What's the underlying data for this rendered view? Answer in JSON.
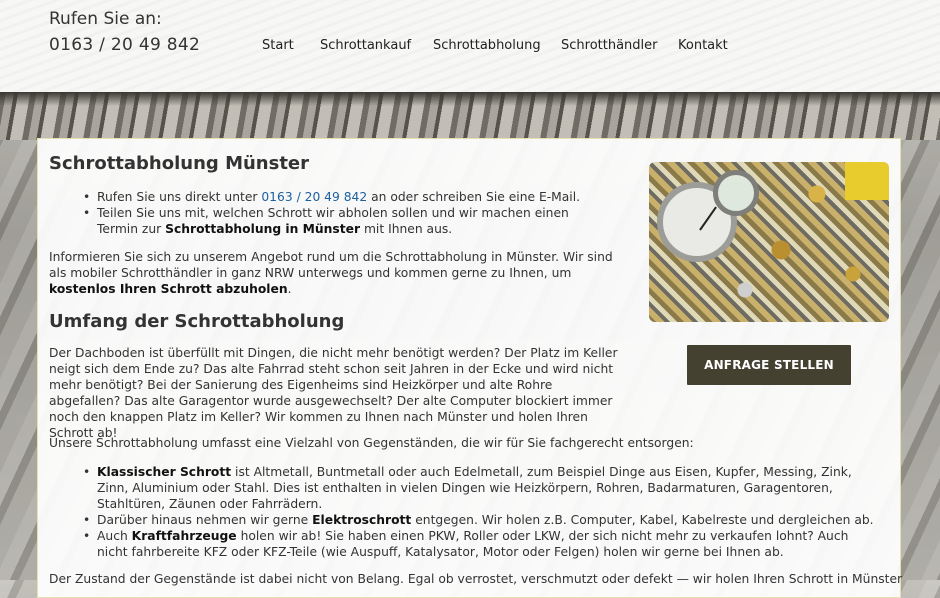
{
  "header": {
    "phone_label": "Rufen Sie an:",
    "phone_number": "0163 / 20 49 842",
    "nav": [
      "Start",
      "Schrottankauf",
      "Schrottabholung",
      "Schrotthändler",
      "Kontakt"
    ]
  },
  "main": {
    "title": "Schrottabholung Münster",
    "intro_bullets": [
      {
        "a": "Rufen Sie uns direkt unter ",
        "link": "0163 / 20 49 842",
        "b": " an oder schreiben Sie eine E-Mail."
      },
      {
        "a": "Teilen Sie uns mit, welchen Schrott wir abholen sollen und wir machen einen Termin zur ",
        "bold": "Schrottabholung in Münster",
        "b": " mit Ihnen aus."
      }
    ],
    "intro_paragraph": {
      "a": "Informieren Sie sich zu unserem Angebot rund um die Schrottabholung in Münster. Wir sind als mobiler Schrotthändler in ganz NRW unterwegs und kommen gerne zu Ihnen, um ",
      "bold": "kostenlos Ihren Schrott abzuholen",
      "b": "."
    },
    "section_title": "Umfang der Schrottabholung",
    "section_paragraph": "Der Dachboden ist überfüllt mit Dingen, die nicht mehr benötigt werden? Der Platz im Keller neigt sich dem Ende zu? Das alte Fahrrad steht schon seit Jahren in der Ecke und wird nicht mehr benötigt? Bei der Sanierung des Eigenheims sind Heizkörper und alte Rohre abgefallen? Das alte Garagentor wurde ausgewechselt? Der alte Computer blockiert immer noch den knappen Platz im Keller? Wir kommen zu Ihnen nach Münster und holen Ihren Schrott ab!",
    "items_intro": "Unsere Schrottabholung umfasst eine Vielzahl von Gegenständen, die wir für Sie fachgerecht entsorgen:",
    "items": [
      {
        "a": "",
        "bold": "Klassischer Schrott",
        "b": " ist Altmetall, Buntmetall oder auch Edelmetall, zum Beispiel Dinge aus Eisen, Kupfer, Messing, Zink, Zinn, Aluminium oder Stahl. Dies ist enthalten in vielen Dingen wie Heizkörpern, Rohren, Badarmaturen, Garagentoren, Stahltüren, Zäunen oder Fahrrädern."
      },
      {
        "a": "Darüber hinaus nehmen wir gerne ",
        "bold": "Elektroschrott",
        "b": " entgegen. Wir holen z.B. Computer, Kabel, Kabelreste und dergleichen ab."
      },
      {
        "a": "Auch ",
        "bold": "Kraftfahrzeuge",
        "b": " holen wir ab! Sie haben einen PKW, Roller oder LKW, der sich nicht mehr zu verkaufen lohnt? Auch nicht fahrbereite KFZ oder KFZ-Teile (wie Auspuff, Katalysator, Motor oder Felgen) holen wir gerne bei Ihnen ab."
      }
    ],
    "closing_partial": "Der Zustand der Gegenstände ist dabei nicht von Belang. Egal ob verrostet, verschmutzt oder defekt — wir holen Ihren Schrott in Münster"
  },
  "sidebar": {
    "cta_label": "ANFRAGE STELLEN"
  },
  "colors": {
    "cta_bg": "#444131",
    "link": "#1b5f9e",
    "panel_border": "#e7dfb2"
  }
}
